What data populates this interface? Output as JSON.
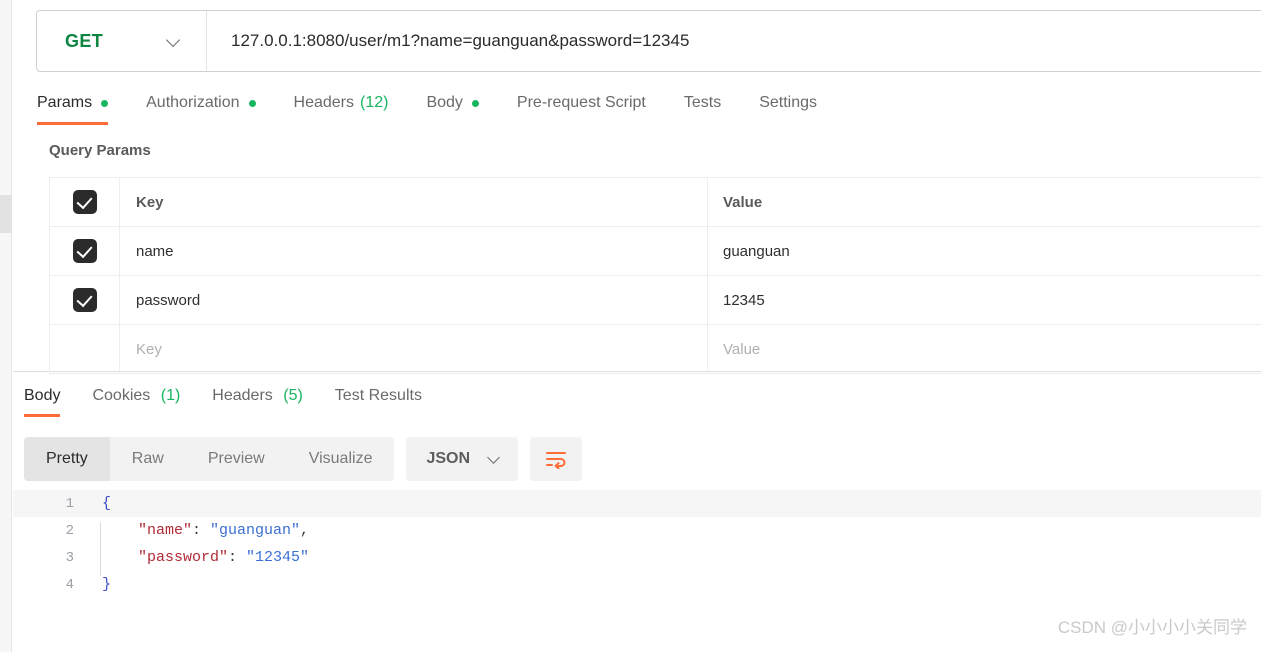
{
  "request": {
    "method": "GET",
    "method_color": "#0c8540",
    "url": "127.0.0.1:8080/user/m1?name=guanguan&password=12345",
    "tabs": [
      {
        "label": "Params",
        "badge": "",
        "dot": true,
        "active": true
      },
      {
        "label": "Authorization",
        "badge": "",
        "dot": true,
        "active": false
      },
      {
        "label": "Headers",
        "badge": "(12)",
        "dot": false,
        "active": false
      },
      {
        "label": "Body",
        "badge": "",
        "dot": true,
        "active": false
      },
      {
        "label": "Pre-request Script",
        "badge": "",
        "dot": false,
        "active": false
      },
      {
        "label": "Tests",
        "badge": "",
        "dot": false,
        "active": false
      },
      {
        "label": "Settings",
        "badge": "",
        "dot": false,
        "active": false
      }
    ],
    "params_section_title": "Query Params",
    "params_headers": {
      "key": "Key",
      "value": "Value"
    },
    "params_rows": [
      {
        "checked": true,
        "key": "name",
        "value": "guanguan"
      },
      {
        "checked": true,
        "key": "password",
        "value": "12345"
      }
    ],
    "params_placeholder_row": {
      "key": "Key",
      "value": "Value"
    }
  },
  "response": {
    "tabs": [
      {
        "label": "Body",
        "badge": "",
        "active": true
      },
      {
        "label": "Cookies",
        "badge": "(1)",
        "active": false
      },
      {
        "label": "Headers",
        "badge": "(5)",
        "active": false
      },
      {
        "label": "Test Results",
        "badge": "",
        "active": false
      }
    ],
    "view_modes": [
      {
        "label": "Pretty",
        "active": true
      },
      {
        "label": "Raw",
        "active": false
      },
      {
        "label": "Preview",
        "active": false
      },
      {
        "label": "Visualize",
        "active": false
      }
    ],
    "format": "JSON",
    "wrap_icon": "word-wrap-icon",
    "wrap_icon_color": "#ff6c37",
    "body_lines": [
      {
        "n": "1",
        "indent": false,
        "highlight": true,
        "tokens": [
          {
            "t": "{",
            "c": "brace"
          }
        ]
      },
      {
        "n": "2",
        "indent": true,
        "highlight": false,
        "tokens": [
          {
            "t": "    \"name\"",
            "c": "key"
          },
          {
            "t": ": ",
            "c": "punc"
          },
          {
            "t": "\"guanguan\"",
            "c": "str"
          },
          {
            "t": ",",
            "c": "punc"
          }
        ]
      },
      {
        "n": "3",
        "indent": true,
        "highlight": false,
        "tokens": [
          {
            "t": "    \"password\"",
            "c": "key"
          },
          {
            "t": ": ",
            "c": "punc"
          },
          {
            "t": "\"12345\"",
            "c": "str"
          }
        ]
      },
      {
        "n": "4",
        "indent": false,
        "highlight": false,
        "tokens": [
          {
            "t": "}",
            "c": "brace"
          }
        ]
      }
    ]
  },
  "watermark": "CSDN @小小小小关同学",
  "colors": {
    "accent_orange": "#ff6c37",
    "method_green": "#0c8540",
    "badge_green": "#19b562",
    "json_key": "#b02a37",
    "json_string": "#3b6fd4"
  }
}
